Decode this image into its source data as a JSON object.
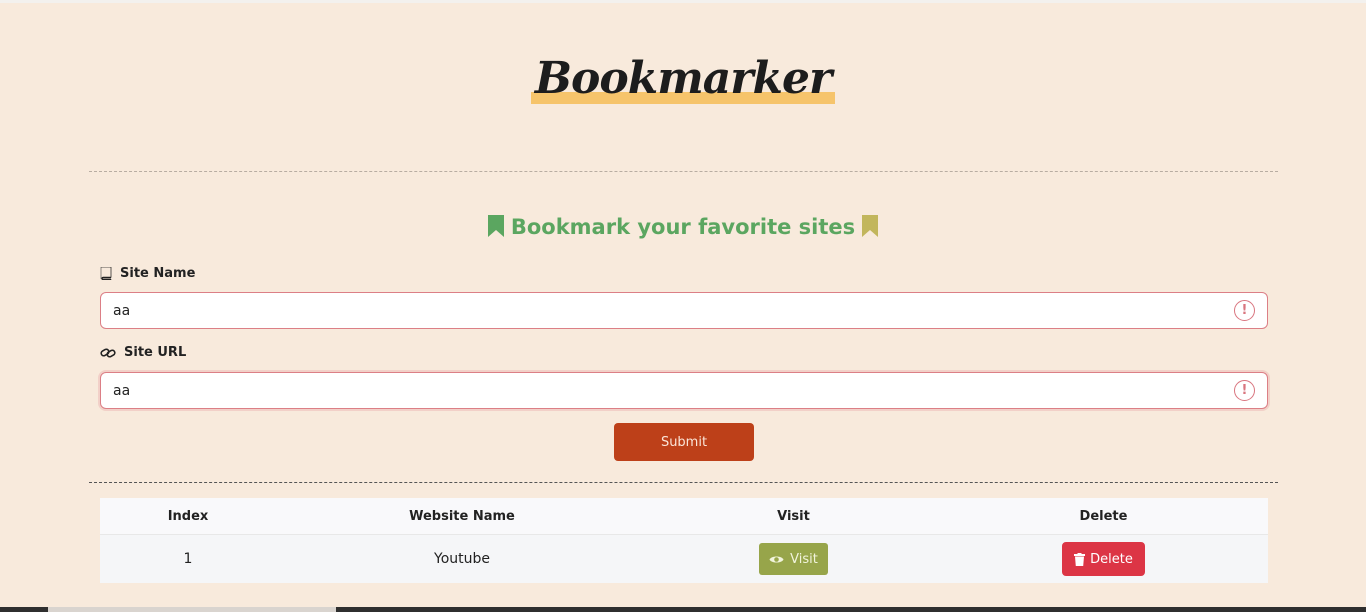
{
  "app": {
    "logo": "Bookmarker",
    "subtitle": "Bookmark your favorite sites"
  },
  "form": {
    "site_name_label": "Site Name",
    "site_name_value": "aa",
    "site_url_label": "Site URL",
    "site_url_value": "aa",
    "submit_label": "Submit"
  },
  "table": {
    "headers": [
      "Index",
      "Website Name",
      "Visit",
      "Delete"
    ],
    "rows": [
      {
        "index": "1",
        "name": "Youtube",
        "visit_label": "Visit",
        "delete_label": "Delete"
      }
    ]
  },
  "colors": {
    "background": "#f8eadc",
    "logo_highlight": "#f6c46b",
    "subtitle_green": "#5ba660",
    "subtitle_olive": "#a6ad55",
    "invalid_border": "#dc7f86",
    "submit": "#bd4019",
    "visit": "#97a54a",
    "delete": "#dc3545"
  },
  "icons": {
    "site_name": "book-icon",
    "site_url": "link-icon",
    "subtitle": "bookmark-icon",
    "invalid": "exclamation-circle-icon",
    "visit": "eye-icon",
    "delete": "trash-icon"
  }
}
